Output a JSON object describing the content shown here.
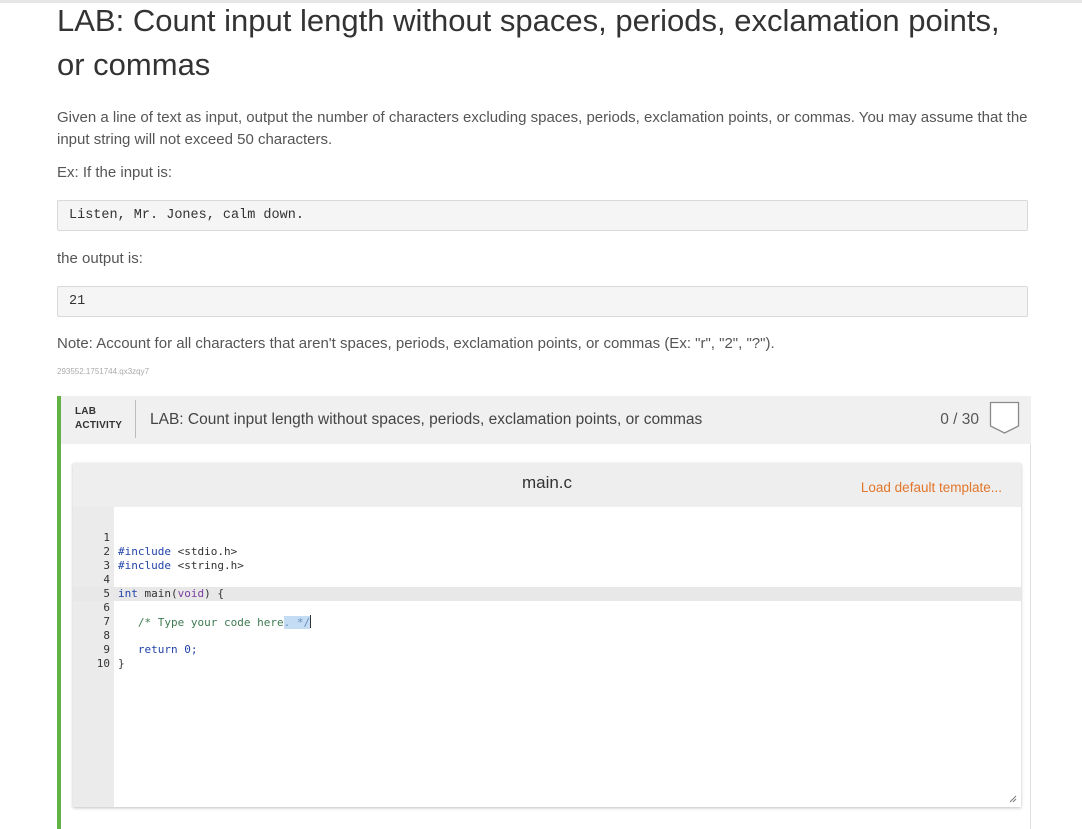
{
  "page": {
    "title": "LAB: Count input length without spaces, periods, exclamation points, or commas",
    "description": "Given a line of text as input, output the number of characters excluding spaces, periods, exclamation points, or commas. You may assume that the input string will not exceed 50 characters.",
    "example_label": "Ex: If the input is:",
    "example_input": "Listen, Mr. Jones, calm down.",
    "output_label": "the output is:",
    "example_output": "21",
    "note": "Note: Account for all characters that aren't spaces, periods, exclamation points, or commas (Ex: \"r\", \"2\", \"?\").",
    "tracking_id": "293552.1751744.qx3zqy7"
  },
  "lab": {
    "tag_line1": "LAB",
    "tag_line2": "ACTIVITY",
    "title": "LAB: Count input length without spaces, periods, exclamation points, or commas",
    "score": "0 / 30",
    "accent_color": "#61b346"
  },
  "editor": {
    "filename": "main.c",
    "load_template_label": "Load default template...",
    "lines": [
      {
        "num": "1",
        "text": "#include <stdio.h>"
      },
      {
        "num": "2",
        "text": "#include <string.h>"
      },
      {
        "num": "3",
        "text": ""
      },
      {
        "num": "4",
        "text": "int main(void) {"
      },
      {
        "num": "5",
        "text": ""
      },
      {
        "num": "6",
        "text": "   /* Type your code here. */"
      },
      {
        "num": "7",
        "text": ""
      },
      {
        "num": "8",
        "text": "   return 0;"
      },
      {
        "num": "9",
        "text": "}"
      },
      {
        "num": "10",
        "text": ""
      }
    ],
    "line1_pre": "#include",
    "line1_post": " <stdio.h>",
    "line2_pre": "#include",
    "line2_post": " <string.h>",
    "line4_int": "int",
    "line4_main": " main(",
    "line4_void": "void",
    "line4_end": ") {",
    "line6_indent": "   ",
    "line6_comment": "/* Type your code here",
    "line6_selected": ". */",
    "line8_code": "   return 0;",
    "line9_code": "}"
  }
}
